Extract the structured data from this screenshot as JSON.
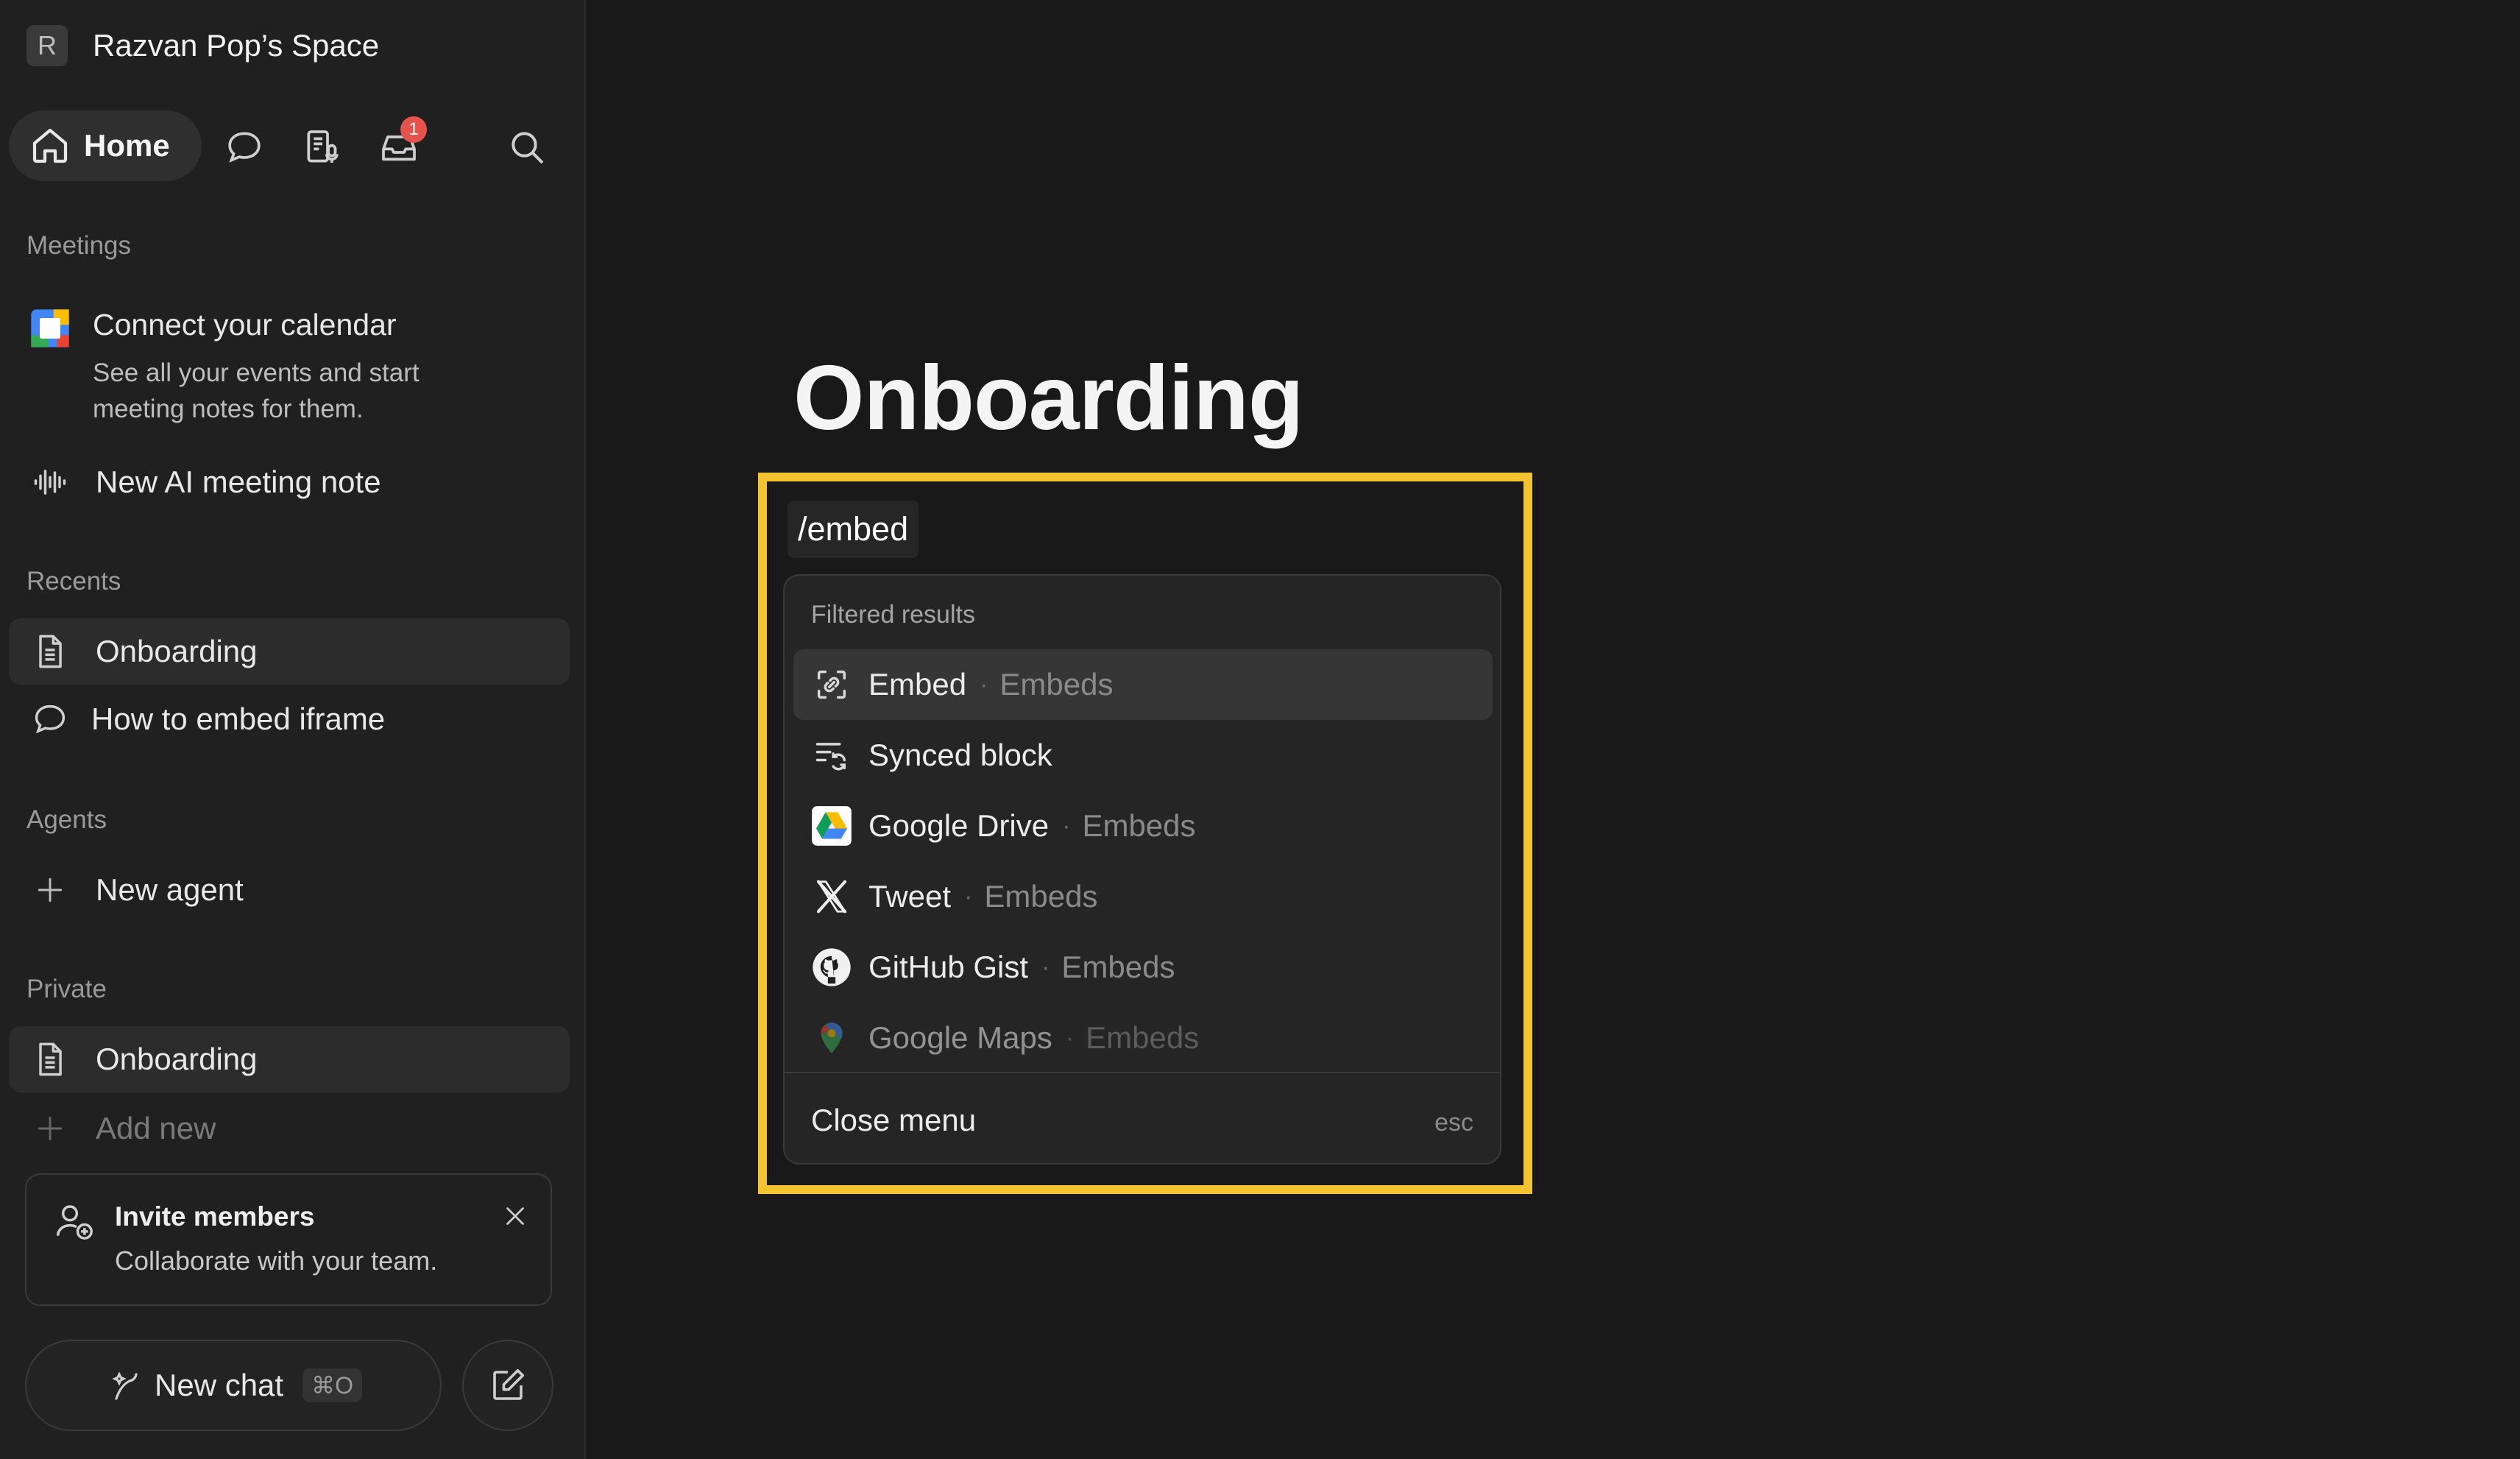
{
  "workspace": {
    "initial": "R",
    "name": "Razvan Pop’s Space"
  },
  "nav": {
    "home_label": "Home",
    "inbox_badge": "1"
  },
  "meetings": {
    "section_label": "Meetings",
    "calendar_title": "Connect your calendar",
    "calendar_desc": "See all your events and start meeting notes for them.",
    "ai_note_label": "New AI meeting note"
  },
  "recents": {
    "section_label": "Recents",
    "items": [
      {
        "label": "Onboarding",
        "icon": "page-icon"
      },
      {
        "label": "How to embed iframe",
        "icon": "chat-bubble-icon"
      }
    ]
  },
  "agents": {
    "section_label": "Agents",
    "new_agent_label": "New agent"
  },
  "private": {
    "section_label": "Private",
    "items": [
      {
        "label": "Onboarding",
        "icon": "page-icon"
      }
    ],
    "add_new_label": "Add new"
  },
  "invite": {
    "title": "Invite members",
    "desc": "Collaborate with your team."
  },
  "bottom": {
    "new_chat_label": "New chat",
    "new_chat_shortcut": "⌘O"
  },
  "page": {
    "title": "Onboarding",
    "slash_text": "/embed"
  },
  "menu": {
    "header": "Filtered results",
    "items": [
      {
        "label": "Embed",
        "category": "Embeds",
        "icon": "embed-link-icon"
      },
      {
        "label": "Synced block",
        "category": "",
        "icon": "synced-block-icon"
      },
      {
        "label": "Google Drive",
        "category": "Embeds",
        "icon": "google-drive-icon"
      },
      {
        "label": "Tweet",
        "category": "Embeds",
        "icon": "x-logo-icon"
      },
      {
        "label": "GitHub Gist",
        "category": "Embeds",
        "icon": "github-icon"
      },
      {
        "label": "Google Maps",
        "category": "Embeds",
        "icon": "google-maps-icon"
      }
    ],
    "separator": "·",
    "close_label": "Close menu",
    "close_shortcut": "esc"
  },
  "colors": {
    "highlight": "#f4c430",
    "badge": "#e5534b",
    "background": "#191919",
    "sidebar": "#202020"
  }
}
